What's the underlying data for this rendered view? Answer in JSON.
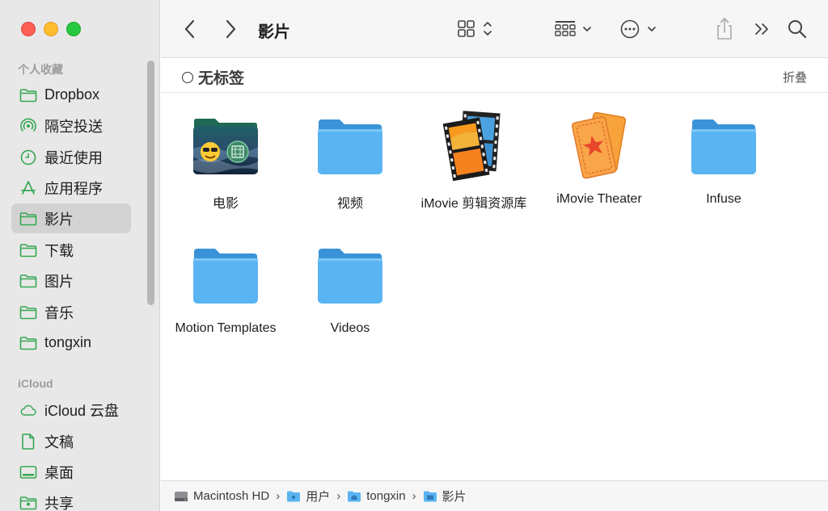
{
  "window": {
    "title": "影片"
  },
  "sidebar": {
    "sections": [
      {
        "label": "个人收藏"
      },
      {
        "label": "iCloud"
      }
    ],
    "items": [
      {
        "label": "Dropbox",
        "icon": "folder-icon"
      },
      {
        "label": "隔空投送",
        "icon": "airdrop-icon"
      },
      {
        "label": "最近使用",
        "icon": "clock-icon"
      },
      {
        "label": "应用程序",
        "icon": "apps-icon"
      },
      {
        "label": "影片",
        "icon": "folder-icon",
        "selected": true
      },
      {
        "label": "下载",
        "icon": "folder-icon"
      },
      {
        "label": "图片",
        "icon": "folder-icon"
      },
      {
        "label": "音乐",
        "icon": "folder-icon"
      },
      {
        "label": "tongxin",
        "icon": "folder-icon"
      },
      {
        "label": "iCloud 云盘",
        "icon": "cloud-icon"
      },
      {
        "label": "文稿",
        "icon": "document-icon"
      },
      {
        "label": "桌面",
        "icon": "desktop-icon"
      },
      {
        "label": "共享",
        "icon": "shared-folder-icon"
      }
    ]
  },
  "tagbar": {
    "label": "无标签",
    "collapse": "折叠"
  },
  "files": [
    {
      "name": "电影",
      "icon": "tv-folder-icon"
    },
    {
      "name": "视频",
      "icon": "folder-icon"
    },
    {
      "name": "iMovie 剪辑资源库",
      "icon": "film-strip-icon"
    },
    {
      "name": "iMovie Theater",
      "icon": "tickets-icon"
    },
    {
      "name": "Infuse",
      "icon": "folder-icon"
    },
    {
      "name": "Motion Templates",
      "icon": "folder-icon"
    },
    {
      "name": "Videos",
      "icon": "folder-icon"
    }
  ],
  "pathbar": {
    "crumbs": [
      "Macintosh HD",
      "用户",
      "tongxin",
      "影片"
    ]
  },
  "colors": {
    "accent": "#34a853",
    "folder": "#5ab4f2",
    "selection": "#d3d2d2"
  }
}
